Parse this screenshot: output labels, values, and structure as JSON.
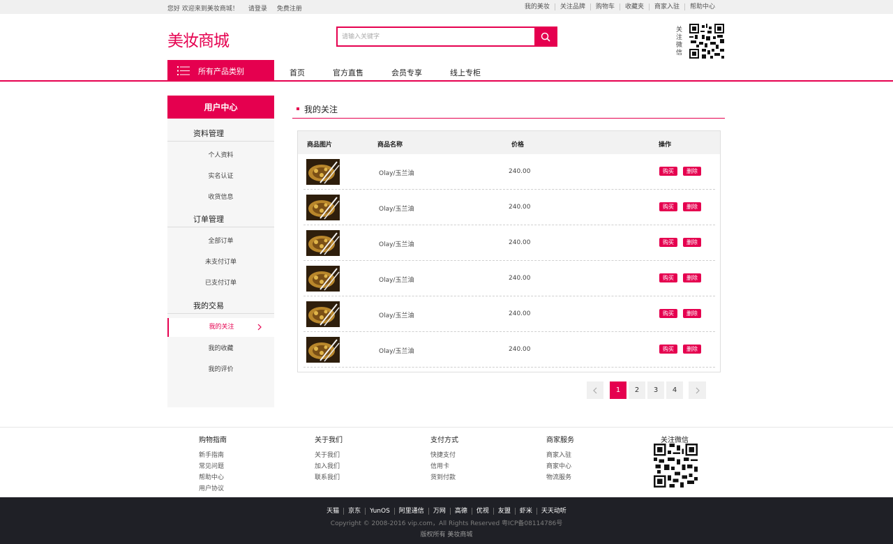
{
  "topbar": {
    "welcome": "您好 欢迎来到美妆商城！",
    "login": "请登录",
    "register": "免费注册",
    "links": [
      "我的美妆",
      "关注品牌",
      "购物车",
      "收藏夹",
      "商家入驻",
      "帮助中心"
    ]
  },
  "header": {
    "logo": "美妆商城",
    "search_placeholder": "请输入关键字",
    "wechat_label": "关注微信"
  },
  "nav": {
    "all_categories": "所有产品类别",
    "links": [
      "首页",
      "官方直售",
      "会员专享",
      "线上专柜"
    ]
  },
  "sidebar": {
    "title": "用户中心",
    "groups": [
      {
        "title": "资料管理",
        "items": [
          "个人资料",
          "实名认证",
          "收货信息"
        ]
      },
      {
        "title": "订单管理",
        "items": [
          "全部订单",
          "未支付订单",
          "已支付订单"
        ]
      },
      {
        "title": "我的交易",
        "items": [
          "我的关注",
          "我的收藏",
          "我的评价"
        ]
      }
    ]
  },
  "main": {
    "title": "我的关注",
    "columns": [
      "商品图片",
      "商品名称",
      "价格",
      "操作"
    ],
    "buy_label": "购买",
    "delete_label": "删除",
    "rows": [
      {
        "name": "Olay/玉兰油",
        "price": "240.00"
      },
      {
        "name": "Olay/玉兰油",
        "price": "240.00"
      },
      {
        "name": "Olay/玉兰油",
        "price": "240.00"
      },
      {
        "name": "Olay/玉兰油",
        "price": "240.00"
      },
      {
        "name": "Olay/玉兰油",
        "price": "240.00"
      },
      {
        "name": "Olay/玉兰油",
        "price": "240.00"
      }
    ],
    "pages": [
      "1",
      "2",
      "3",
      "4"
    ],
    "current_page": "1"
  },
  "footer": {
    "columns": [
      {
        "title": "购物指南",
        "items": [
          "新手指南",
          "常见问题",
          "帮助中心",
          "用户协议"
        ]
      },
      {
        "title": "关于我们",
        "items": [
          "关于我们",
          "加入我们",
          "联系我们"
        ]
      },
      {
        "title": "支付方式",
        "items": [
          "快捷支付",
          "信用卡",
          "货到付款"
        ]
      },
      {
        "title": "商家服务",
        "items": [
          "商家入驻",
          "商家中心",
          "物流服务"
        ]
      }
    ],
    "wechat_title": "关注微信",
    "bottom_links": [
      "天猫",
      "京东",
      "YunOS",
      "阿里通信",
      "万网",
      "高德",
      "优视",
      "友盟",
      "虾米",
      "天天动听"
    ],
    "copyright": "Copyright © 2008-2016 vip.com，All Rights Reserved 粤ICP备08114786号",
    "rights": "版权所有  美妆商城"
  },
  "colors": {
    "accent": "#e5004f",
    "footer_bg": "#1f2026"
  }
}
